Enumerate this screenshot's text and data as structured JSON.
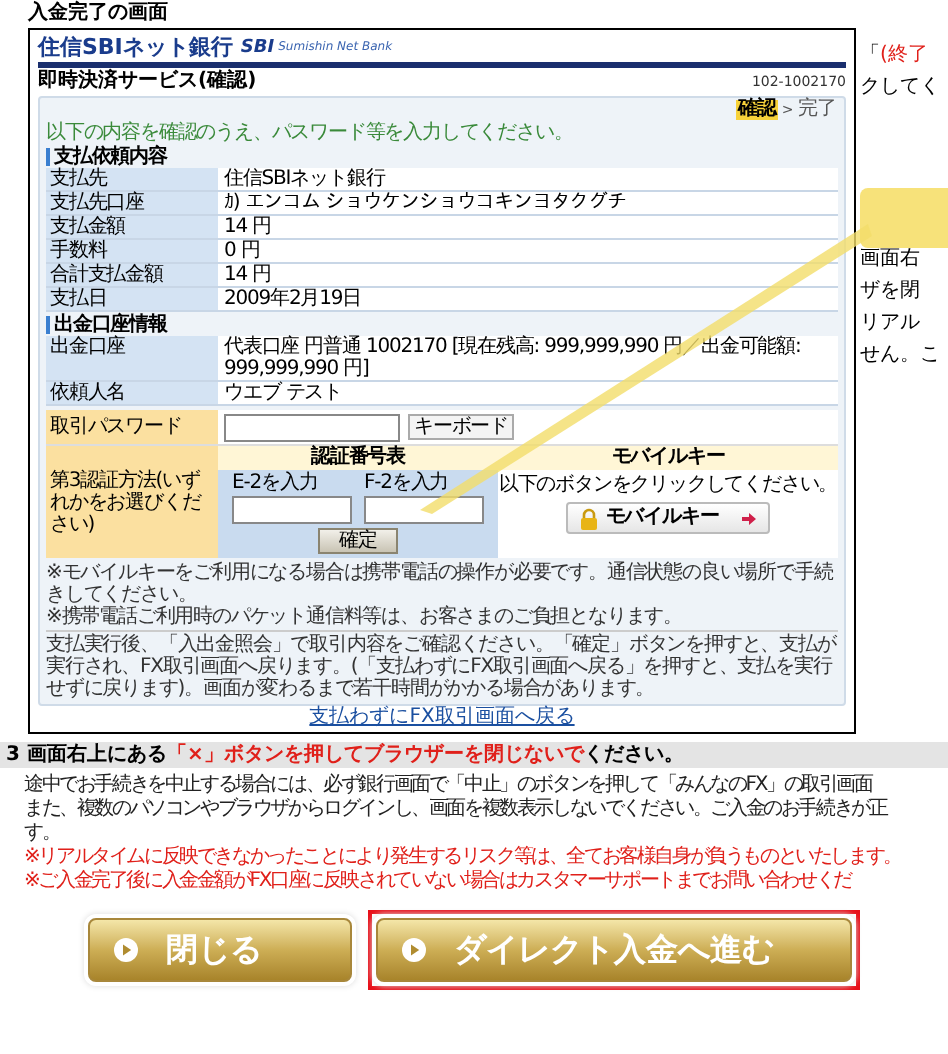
{
  "section_title": "入金完了の画面",
  "bank_screen": {
    "logo": "住信SBIネット銀行",
    "logo_mark": "SBI",
    "logo_en": "Sumishin Net Bank",
    "page_title": "即時決済サービス(確認)",
    "reference": "102-1002170",
    "steps": [
      {
        "label": "確認",
        "selected": true
      },
      {
        "label": "完了",
        "selected": false
      }
    ],
    "step_separator": ">",
    "instruction": "以下の内容を確認のうえ、パスワード等を入力してください。",
    "sections": [
      {
        "heading": "支払依頼内容",
        "rows": [
          {
            "label": "支払先",
            "value": "住信SBIネット銀行"
          },
          {
            "label": "支払先口座",
            "value": "ｶ) エンコム ショウケンショウコキンヨタクグチ"
          },
          {
            "label": "支払金額",
            "value": "14 円"
          },
          {
            "label": "手数料",
            "value": "0 円"
          },
          {
            "label": "合計支払金額",
            "value": "14 円"
          },
          {
            "label": "支払日",
            "value": "2009年2月19日"
          }
        ]
      },
      {
        "heading": "出金口座情報",
        "rows": [
          {
            "label": "出金口座",
            "value": "代表口座 円普通 1002170 [現在残高: 999,999,990 円／出金可能額: 999,999,990 円]"
          },
          {
            "label": "依頼人名",
            "value": "ウエブ テスト"
          }
        ]
      }
    ],
    "password": {
      "label": "取引パスワード",
      "keyboard_button": "キーボード"
    },
    "auth": {
      "label": "第3認証方法(いずれかをお選びください)",
      "number_table": {
        "heading": "認証番号表",
        "fields": [
          {
            "label": "E-2を入力"
          },
          {
            "label": "F-2を入力"
          }
        ],
        "confirm_button": "確定"
      },
      "mobile_key": {
        "heading": "モバイルキー",
        "instruction": "以下のボタンをクリックしてください。",
        "button": "モバイルキー"
      }
    },
    "notes": [
      "※モバイルキーをご利用になる場合は携帯電話の操作が必要です。通信状態の良い場所で手続きしてください。",
      "※携帯電話ご利用時のパケット通信料等は、お客さまのご負担となります。"
    ],
    "description": "支払実行後、「入出金照会」で取引内容をご確認ください。「確定」ボタンを押すと、支払が実行され、FX取引画面へ戻ります。(「支払わずにFX取引画面へ戻る」を押すと、支払を実行せずに戻ります)。画面が変わるまで若干時間がかかる場合があります。",
    "back_link": "支払わずにFX取引画面へ戻る"
  },
  "side_lines": [
    [
      {
        "text": "「",
        "emphasis": false
      },
      {
        "text": "(終了",
        "emphasis": true
      }
    ],
    [
      {
        "text": "クしてく",
        "emphasis": false
      }
    ],
    [
      {
        "text": "画面右",
        "emphasis": false
      }
    ],
    [
      {
        "text": "ザを閉",
        "emphasis": false
      }
    ],
    [
      {
        "text": "リアル",
        "emphasis": false
      }
    ],
    [
      {
        "text": "せん。こ",
        "emphasis": false
      }
    ]
  ],
  "notice": {
    "heading": [
      {
        "text": "3 画面右上にある",
        "emphasis": false
      },
      {
        "text": "「×」ボタンを押してブラウザーを閉じないで",
        "emphasis": true
      },
      {
        "text": "ください。",
        "emphasis": false
      }
    ],
    "lines": [
      {
        "text": "途中でお手続きを中止する場合には、必ず銀行画面で「中止」のボタンを押して「みんなのFX」の取引画面",
        "emphasis": false
      },
      {
        "text": "また、複数のパソコンやブラウザからログインし、画面を複数表示しないでください。ご入金のお手続きが正",
        "emphasis": false
      },
      {
        "text": "す。",
        "emphasis": false
      },
      {
        "text": "※リアルタイムに反映できなかったことにより発生するリスク等は、全てお客様自身が負うものといたします。",
        "emphasis": true
      },
      {
        "text": "※ご入金完了後に入金金額がFX口座に反映されていない場合はカスタマーサポートまでお問い合わせくだ",
        "emphasis": true
      }
    ]
  },
  "buttons": [
    {
      "label": "閉じる",
      "highlighted": false
    },
    {
      "label": "ダイレクト入金へ進む",
      "highlighted": true
    }
  ]
}
